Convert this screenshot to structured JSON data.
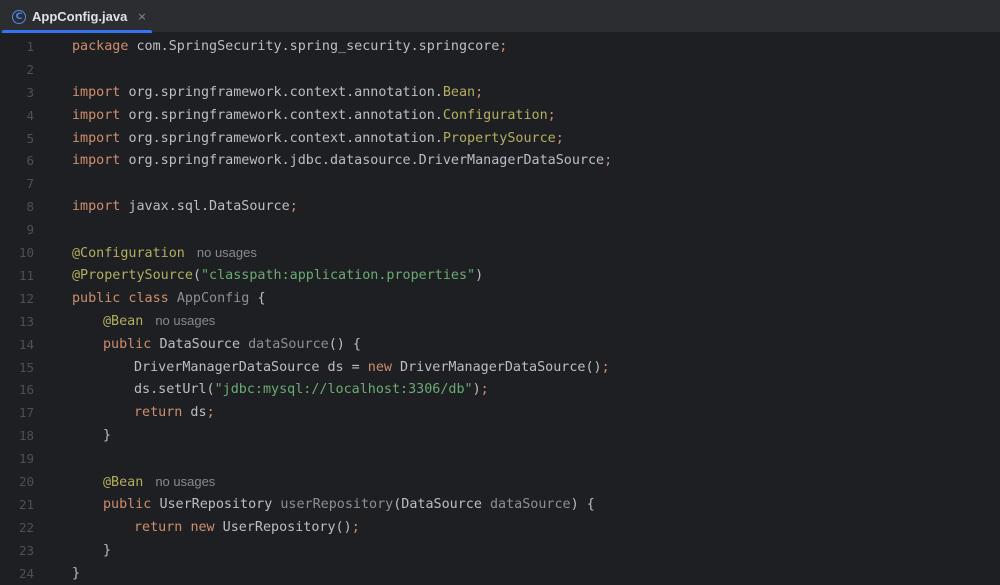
{
  "tab": {
    "title": "AppConfig.java",
    "icon_glyph": "C",
    "close_glyph": "×"
  },
  "hint": {
    "no_usages": "no usages"
  },
  "code": {
    "l1_kw": "package",
    "l1_rest": "com.SpringSecurity.spring_security.springcore",
    "semi": ";",
    "import_kw": "import",
    "l3_pkg": "org.springframework.context.annotation.",
    "l3_cls": "Bean",
    "l4_pkg": "org.springframework.context.annotation.",
    "l4_cls": "Configuration",
    "l5_pkg": "org.springframework.context.annotation.",
    "l5_cls": "PropertySource",
    "l6_pkg": "org.springframework.jdbc.datasource.DriverManagerDataSource",
    "l8_pkg": "javax.sql.DataSource",
    "l10_ann": "@Configuration",
    "l11_ann": "@PropertySource",
    "l11_open": "(",
    "l11_str": "\"classpath:application.properties\"",
    "l11_close": ")",
    "l12_kw": "public class",
    "l12_name": "AppConfig",
    "l12_brace": "{",
    "bean_ann": "@Bean",
    "l14_kw": "public",
    "l14_type": "DataSource",
    "l14_name": "dataSource",
    "l14_rest": "() {",
    "l15_a": "DriverManagerDataSource ds = ",
    "l15_new": "new",
    "l15_b": " DriverManagerDataSource()",
    "l16_a": "ds.setUrl(",
    "l16_str": "\"jdbc:mysql://localhost:3306/db\"",
    "l16_b": ")",
    "l17_kw": "return",
    "l17_rest": " ds",
    "close_brace": "}",
    "l21_kw": "public",
    "l21_type": "UserRepository",
    "l21_name": "userRepository",
    "l21_open": "(DataSource ",
    "l21_param": "dataSource",
    "l21_close": ") {",
    "l22_kw": "return",
    "l22_new": "new",
    "l22_rest": " UserRepository()"
  },
  "line_numbers": [
    "1",
    "2",
    "3",
    "4",
    "5",
    "6",
    "7",
    "8",
    "9",
    "10",
    "11",
    "12",
    "13",
    "14",
    "15",
    "16",
    "17",
    "18",
    "19",
    "20",
    "21",
    "22",
    "23",
    "24"
  ]
}
